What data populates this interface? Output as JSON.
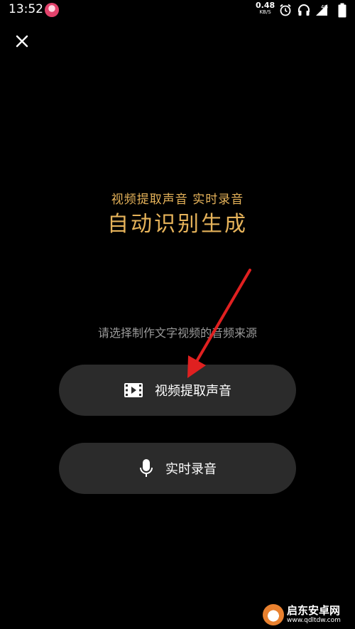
{
  "status_bar": {
    "time": "13:52",
    "net_speed_value": "0.48",
    "net_speed_unit": "KB/S",
    "network_type": "4G",
    "icons": [
      "notification-avatar-icon",
      "alarm-icon",
      "headphones-icon",
      "signal-icon",
      "battery-icon"
    ]
  },
  "header": {
    "close_icon": "close-icon"
  },
  "hero": {
    "subtitle": "视频提取声音 实时录音",
    "title": "自动识别生成"
  },
  "prompt": "请选择制作文字视频的音频来源",
  "options": [
    {
      "label": "视频提取声音",
      "icon": "video-film-icon"
    },
    {
      "label": "实时录音",
      "icon": "microphone-icon"
    }
  ],
  "watermark": {
    "name": "启东安卓网",
    "url": "www.qdltdw.com"
  },
  "colors": {
    "background": "#000000",
    "accent_gold": "#e6b35a",
    "button_bg": "#2b2b2b",
    "prompt_text": "#9a9a9a",
    "arrow_red": "#e02020"
  }
}
